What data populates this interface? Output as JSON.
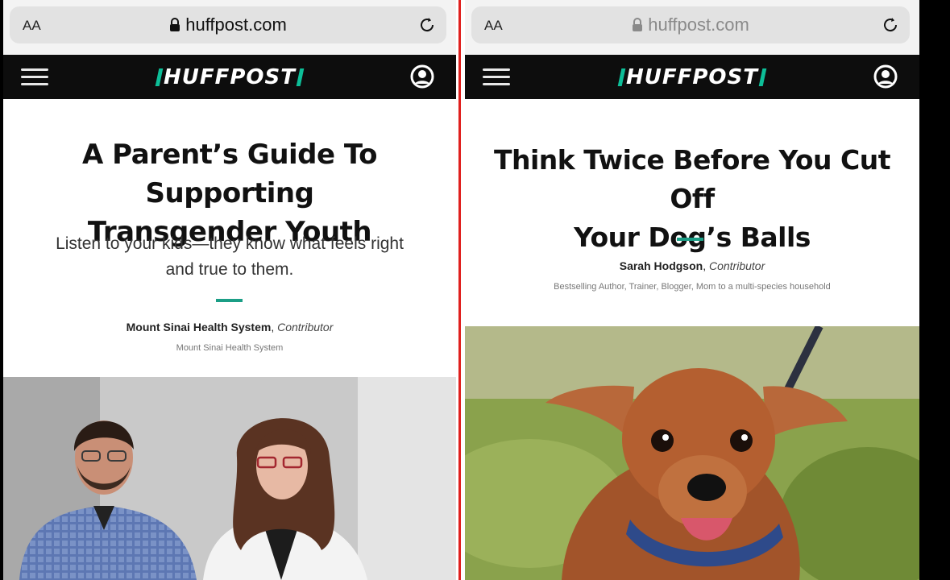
{
  "left": {
    "browser": {
      "text_size": "AA",
      "url": "huffpost.com"
    },
    "site": {
      "logo": "HUFFPOST"
    },
    "article": {
      "headline_line1": "A Parent’s Guide To Supporting",
      "headline_line2": "Transgender Youth",
      "dek_line1": "Listen to your kids—they know what feels right",
      "dek_line2": "and true to them.",
      "author": "Mount Sinai Health System",
      "role": "Contributor",
      "bio": "Mount Sinai Health System",
      "image": "photo of two people smiling, seated side by side"
    }
  },
  "right": {
    "browser": {
      "text_size": "AA",
      "url": "huffpost.com"
    },
    "site": {
      "logo": "HUFFPOST"
    },
    "article": {
      "headline_line1": "Think Twice Before You Cut Off",
      "headline_line2": "Your Dog’s Balls",
      "author": "Sarah Hodgson",
      "role": "Contributor",
      "bio": "Bestselling Author, Trainer, Blogger, Mom to a multi-species household",
      "image": "photo of a small brown dog on a leash in grass"
    }
  },
  "colors": {
    "accent": "#1b9e86",
    "divider": "#e0201e",
    "navbar": "#0d0d0d"
  },
  "icons": [
    "lock-icon",
    "reload-icon",
    "menu-icon",
    "account-icon"
  ]
}
